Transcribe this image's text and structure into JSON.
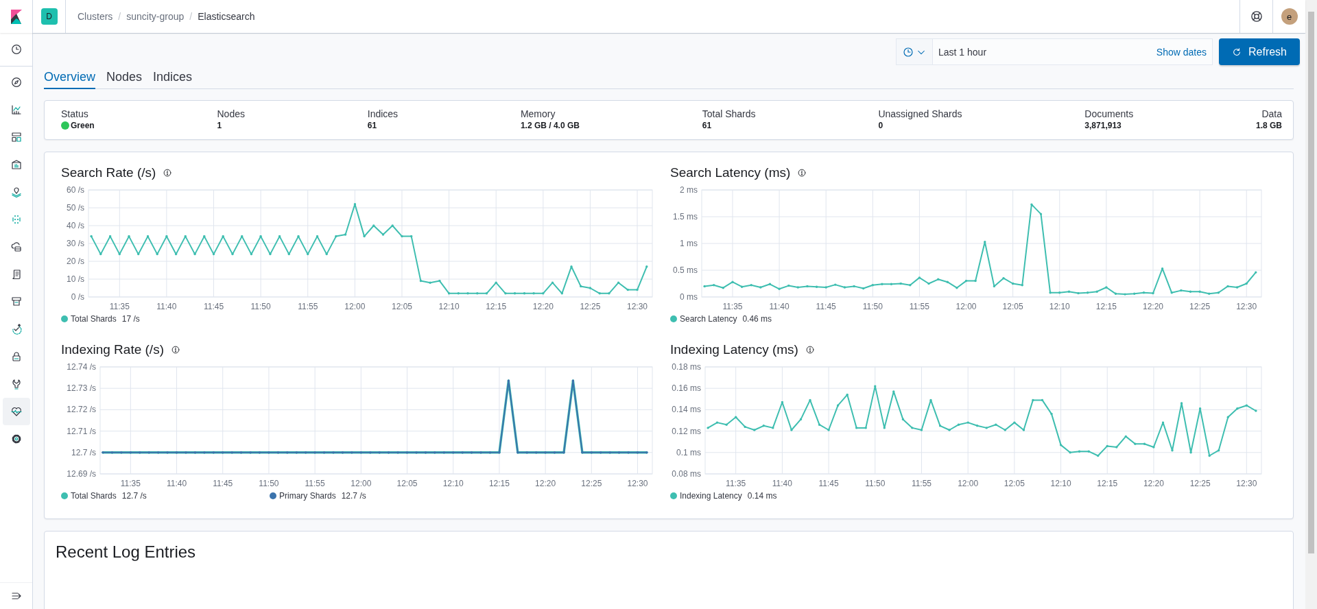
{
  "header": {
    "space_badge": "D",
    "separator": "/",
    "breadcrumbs": [
      {
        "label": "Clusters",
        "current": false
      },
      {
        "label": "suncity-group",
        "current": false
      },
      {
        "label": "Elasticsearch",
        "current": true
      }
    ],
    "avatar": "e"
  },
  "sidebar": {
    "items": [
      {
        "selected": false
      },
      {
        "selected": false
      },
      {
        "selected": false
      },
      {
        "selected": false
      },
      {
        "selected": false
      },
      {
        "selected": false
      },
      {
        "selected": false
      },
      {
        "selected": false
      },
      {
        "selected": false
      },
      {
        "selected": false
      },
      {
        "selected": false
      },
      {
        "selected": false
      },
      {
        "selected": false
      },
      {
        "selected": true
      },
      {
        "selected": false
      }
    ]
  },
  "time_picker": {
    "range": "Last 1 hour",
    "show_dates": "Show dates"
  },
  "refresh_button": "Refresh",
  "tabs": [
    {
      "label": "Overview",
      "selected": true
    },
    {
      "label": "Nodes",
      "selected": false
    },
    {
      "label": "Indices",
      "selected": false
    }
  ],
  "stats": [
    {
      "label": "Status",
      "value": "Green",
      "color": "#2ec65a"
    },
    {
      "label": "Nodes",
      "value": "1"
    },
    {
      "label": "Indices",
      "value": "61"
    },
    {
      "label": "Memory",
      "value": "1.2 GB / 4.0 GB"
    },
    {
      "label": "Total Shards",
      "value": "61"
    },
    {
      "label": "Unassigned Shards",
      "value": "0"
    },
    {
      "label": "Documents",
      "value": "3,871,913"
    },
    {
      "label": "Data",
      "value": "1.8 GB"
    }
  ],
  "charts": [
    {
      "title": "Search Rate (/s)",
      "legend_readings": [
        "17 /s"
      ],
      "chart_data": {
        "type": "line",
        "grid": true,
        "categories": [
          null,
          null,
          null,
          "11:35",
          null,
          null,
          null,
          null,
          "11:40",
          null,
          null,
          null,
          null,
          "11:45",
          null,
          null,
          null,
          null,
          "11:50",
          null,
          null,
          null,
          null,
          "11:55",
          null,
          null,
          null,
          null,
          "12:00",
          null,
          null,
          null,
          null,
          "12:05",
          null,
          null,
          null,
          null,
          "12:10",
          null,
          null,
          null,
          null,
          "12:15",
          null,
          null,
          null,
          null,
          "12:20",
          null,
          null,
          null,
          null,
          "12:25",
          null,
          null,
          null,
          null,
          "12:30",
          null
        ],
        "ylim": [
          0,
          60
        ],
        "yticks": [
          {
            "value": 0,
            "label": "0 /s"
          },
          {
            "value": 10,
            "label": "10 /s"
          },
          {
            "value": 20,
            "label": "20 /s"
          },
          {
            "value": 30,
            "label": "30 /s"
          },
          {
            "value": 40,
            "label": "40 /s"
          },
          {
            "value": 50,
            "label": "50 /s"
          },
          {
            "value": 60,
            "label": "60 /s"
          }
        ],
        "series": [
          {
            "name": "Total Shards",
            "color": "#3ebeb0",
            "values": [
              34,
              24,
              34,
              24,
              34,
              24,
              34,
              24,
              34,
              24,
              34,
              24,
              34,
              24,
              34,
              24,
              34,
              24,
              34,
              24,
              34,
              24,
              34,
              24,
              34,
              24,
              34,
              35,
              52,
              34,
              40,
              35,
              40,
              34,
              34,
              9,
              8,
              9,
              2,
              2,
              2,
              2,
              2,
              8,
              2,
              2,
              2,
              2,
              2,
              8,
              2,
              17,
              6,
              5,
              2,
              2,
              8,
              4,
              4,
              17
            ]
          }
        ]
      }
    },
    {
      "title": "Search Latency (ms)",
      "legend_readings": [
        "0.46 ms"
      ],
      "chart_data": {
        "type": "line",
        "grid": true,
        "categories": [
          null,
          null,
          null,
          "11:35",
          null,
          null,
          null,
          null,
          "11:40",
          null,
          null,
          null,
          null,
          "11:45",
          null,
          null,
          null,
          null,
          "11:50",
          null,
          null,
          null,
          null,
          "11:55",
          null,
          null,
          null,
          null,
          "12:00",
          null,
          null,
          null,
          null,
          "12:05",
          null,
          null,
          null,
          null,
          "12:10",
          null,
          null,
          null,
          null,
          "12:15",
          null,
          null,
          null,
          null,
          "12:20",
          null,
          null,
          null,
          null,
          "12:25",
          null,
          null,
          null,
          null,
          "12:30",
          null
        ],
        "ylim": [
          0,
          2
        ],
        "yticks": [
          {
            "value": 0,
            "label": "0 ms"
          },
          {
            "value": 0.5,
            "label": "0.5 ms"
          },
          {
            "value": 1,
            "label": "1 ms"
          },
          {
            "value": 1.5,
            "label": "1.5 ms"
          },
          {
            "value": 2,
            "label": "2 ms"
          }
        ],
        "series": [
          {
            "name": "Search Latency",
            "color": "#3ebeb0",
            "values": [
              0.2,
              0.22,
              0.17,
              0.28,
              0.19,
              0.22,
              0.18,
              0.24,
              0.15,
              0.21,
              0.18,
              0.2,
              0.19,
              0.18,
              0.23,
              0.18,
              0.2,
              0.16,
              0.22,
              0.24,
              0.24,
              0.25,
              0.22,
              0.36,
              0.25,
              0.33,
              0.28,
              0.17,
              0.3,
              0.3,
              1.03,
              0.2,
              0.35,
              0.25,
              0.22,
              1.73,
              1.55,
              0.08,
              0.08,
              0.1,
              0.07,
              0.08,
              0.1,
              0.18,
              0.06,
              0.05,
              0.06,
              0.08,
              0.07,
              0.53,
              0.08,
              0.12,
              0.1,
              0.1,
              0.06,
              0.08,
              0.2,
              0.18,
              0.25,
              0.46
            ]
          }
        ]
      }
    },
    {
      "title": "Indexing Rate (/s)",
      "legend_readings": [
        "12.7 /s",
        "12.7 /s"
      ],
      "chart_data": {
        "type": "line",
        "grid": true,
        "categories": [
          null,
          null,
          null,
          "11:35",
          null,
          null,
          null,
          null,
          "11:40",
          null,
          null,
          null,
          null,
          "11:45",
          null,
          null,
          null,
          null,
          "11:50",
          null,
          null,
          null,
          null,
          "11:55",
          null,
          null,
          null,
          null,
          "12:00",
          null,
          null,
          null,
          null,
          "12:05",
          null,
          null,
          null,
          null,
          "12:10",
          null,
          null,
          null,
          null,
          "12:15",
          null,
          null,
          null,
          null,
          "12:20",
          null,
          null,
          null,
          null,
          "12:25",
          null,
          null,
          null,
          null,
          "12:30",
          null
        ],
        "ylim": [
          12.69,
          12.74
        ],
        "yticks": [
          {
            "value": 12.69,
            "label": "12.69 /s"
          },
          {
            "value": 12.7,
            "label": "12.7 /s"
          },
          {
            "value": 12.71,
            "label": "12.71 /s"
          },
          {
            "value": 12.72,
            "label": "12.72 /s"
          },
          {
            "value": 12.73,
            "label": "12.73 /s"
          },
          {
            "value": 12.74,
            "label": "12.74 /s"
          }
        ],
        "series": [
          {
            "name": "Total Shards",
            "color": "#3ebeb0",
            "values": [
              12.7,
              12.7,
              12.7,
              12.7,
              12.7,
              12.7,
              12.7,
              12.7,
              12.7,
              12.7,
              12.7,
              12.7,
              12.7,
              12.7,
              12.7,
              12.7,
              12.7,
              12.7,
              12.7,
              12.7,
              12.7,
              12.7,
              12.7,
              12.7,
              12.7,
              12.7,
              12.7,
              12.7,
              12.7,
              12.7,
              12.7,
              12.7,
              12.7,
              12.7,
              12.7,
              12.7,
              12.7,
              12.7,
              12.7,
              12.7,
              12.7,
              12.7,
              12.7,
              12.7,
              12.7335,
              12.7,
              12.7,
              12.7,
              12.7,
              12.7,
              12.7,
              12.7335,
              12.7,
              12.7,
              12.7,
              12.7,
              12.7,
              12.7,
              12.7,
              12.7
            ]
          },
          {
            "name": "Primary Shards",
            "color": "#3b73ac",
            "values": [
              12.7,
              12.7,
              12.7,
              12.7,
              12.7,
              12.7,
              12.7,
              12.7,
              12.7,
              12.7,
              12.7,
              12.7,
              12.7,
              12.7,
              12.7,
              12.7,
              12.7,
              12.7,
              12.7,
              12.7,
              12.7,
              12.7,
              12.7,
              12.7,
              12.7,
              12.7,
              12.7,
              12.7,
              12.7,
              12.7,
              12.7,
              12.7,
              12.7,
              12.7,
              12.7,
              12.7,
              12.7,
              12.7,
              12.7,
              12.7,
              12.7,
              12.7,
              12.7,
              12.7,
              12.7335,
              12.7,
              12.7,
              12.7,
              12.7,
              12.7,
              12.7,
              12.7335,
              12.7,
              12.7,
              12.7,
              12.7,
              12.7,
              12.7,
              12.7,
              12.7
            ]
          }
        ]
      }
    },
    {
      "title": "Indexing Latency (ms)",
      "legend_readings": [
        "0.14 ms"
      ],
      "chart_data": {
        "type": "line",
        "grid": true,
        "categories": [
          null,
          null,
          null,
          "11:35",
          null,
          null,
          null,
          null,
          "11:40",
          null,
          null,
          null,
          null,
          "11:45",
          null,
          null,
          null,
          null,
          "11:50",
          null,
          null,
          null,
          null,
          "11:55",
          null,
          null,
          null,
          null,
          "12:00",
          null,
          null,
          null,
          null,
          "12:05",
          null,
          null,
          null,
          null,
          "12:10",
          null,
          null,
          null,
          null,
          "12:15",
          null,
          null,
          null,
          null,
          "12:20",
          null,
          null,
          null,
          null,
          "12:25",
          null,
          null,
          null,
          null,
          "12:30",
          null
        ],
        "ylim": [
          0.08,
          0.18
        ],
        "yticks": [
          {
            "value": 0.08,
            "label": "0.08 ms"
          },
          {
            "value": 0.1,
            "label": "0.1 ms"
          },
          {
            "value": 0.12,
            "label": "0.12 ms"
          },
          {
            "value": 0.14,
            "label": "0.14 ms"
          },
          {
            "value": 0.16,
            "label": "0.16 ms"
          },
          {
            "value": 0.18,
            "label": "0.18 ms"
          }
        ],
        "series": [
          {
            "name": "Indexing Latency",
            "color": "#3ebeb0",
            "values": [
              0.123,
              0.128,
              0.126,
              0.133,
              0.124,
              0.121,
              0.125,
              0.123,
              0.147,
              0.121,
              0.131,
              0.149,
              0.126,
              0.121,
              0.144,
              0.154,
              0.123,
              0.123,
              0.162,
              0.123,
              0.157,
              0.131,
              0.123,
              0.121,
              0.149,
              0.125,
              0.121,
              0.126,
              0.128,
              0.125,
              0.123,
              0.126,
              0.121,
              0.128,
              0.121,
              0.149,
              0.149,
              0.136,
              0.107,
              0.1,
              0.101,
              0.101,
              0.097,
              0.106,
              0.105,
              0.115,
              0.108,
              0.108,
              0.105,
              0.128,
              0.102,
              0.146,
              0.1,
              0.141,
              0.097,
              0.102,
              0.133,
              0.141,
              0.144,
              0.139
            ]
          }
        ]
      }
    }
  ],
  "log_panel": {
    "title": "Recent Log Entries"
  }
}
